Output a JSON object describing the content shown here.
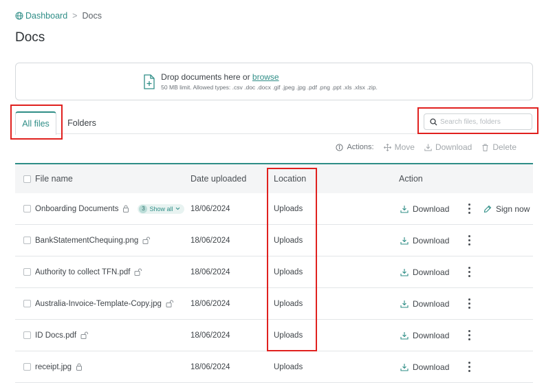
{
  "breadcrumb": {
    "home": "Dashboard",
    "separator": ">",
    "current": "Docs"
  },
  "page": {
    "title": "Docs"
  },
  "upload": {
    "text_prefix": "Drop documents here or ",
    "link": "browse",
    "limits": "50 MB limit. Allowed types: .csv .doc .docx .gif .jpeg .jpg .pdf .png .ppt .xls .xlsx .zip."
  },
  "tabs": [
    {
      "label": "All files",
      "active": true
    },
    {
      "label": "Folders",
      "active": false
    }
  ],
  "search": {
    "placeholder": "Search files, folders",
    "value": ""
  },
  "actions": {
    "label": "Actions:",
    "move": "Move",
    "download": "Download",
    "delete": "Delete"
  },
  "table": {
    "headers": {
      "name": "File name",
      "date": "Date uploaded",
      "location": "Location",
      "action": "Action"
    },
    "rows": [
      {
        "name": "Onboarding Documents",
        "lock": "locked",
        "badge_count": "3",
        "badge_label": "Show all",
        "date": "18/06/2024",
        "location": "Uploads",
        "download": "Download",
        "sign": "Sign now"
      },
      {
        "name": "BankStatementChequing.png",
        "lock": "unlocked",
        "date": "18/06/2024",
        "location": "Uploads",
        "download": "Download"
      },
      {
        "name": "Authority to collect TFN.pdf",
        "lock": "unlocked",
        "date": "18/06/2024",
        "location": "Uploads",
        "download": "Download"
      },
      {
        "name": "Australia-Invoice-Template-Copy.jpg",
        "lock": "unlocked",
        "date": "18/06/2024",
        "location": "Uploads",
        "download": "Download"
      },
      {
        "name": "ID Docs.pdf",
        "lock": "unlocked",
        "date": "18/06/2024",
        "location": "Uploads",
        "download": "Download"
      },
      {
        "name": "receipt.jpg",
        "lock": "locked",
        "date": "18/06/2024",
        "location": "Uploads",
        "download": "Download"
      }
    ]
  },
  "colors": {
    "accent": "#2e8d86",
    "highlight": "#e0201e",
    "header_bg": "#f4f5f6",
    "border": "#e2e5e7"
  },
  "icons": {
    "home": "globe-icon",
    "upload": "file-add-icon",
    "search": "search-icon",
    "info": "info-icon",
    "move": "move-icon",
    "download": "download-icon",
    "delete": "trash-icon",
    "more": "more-vertical-icon",
    "sign": "pen-icon",
    "lock": "lock-icon",
    "unlock": "unlock-icon"
  }
}
